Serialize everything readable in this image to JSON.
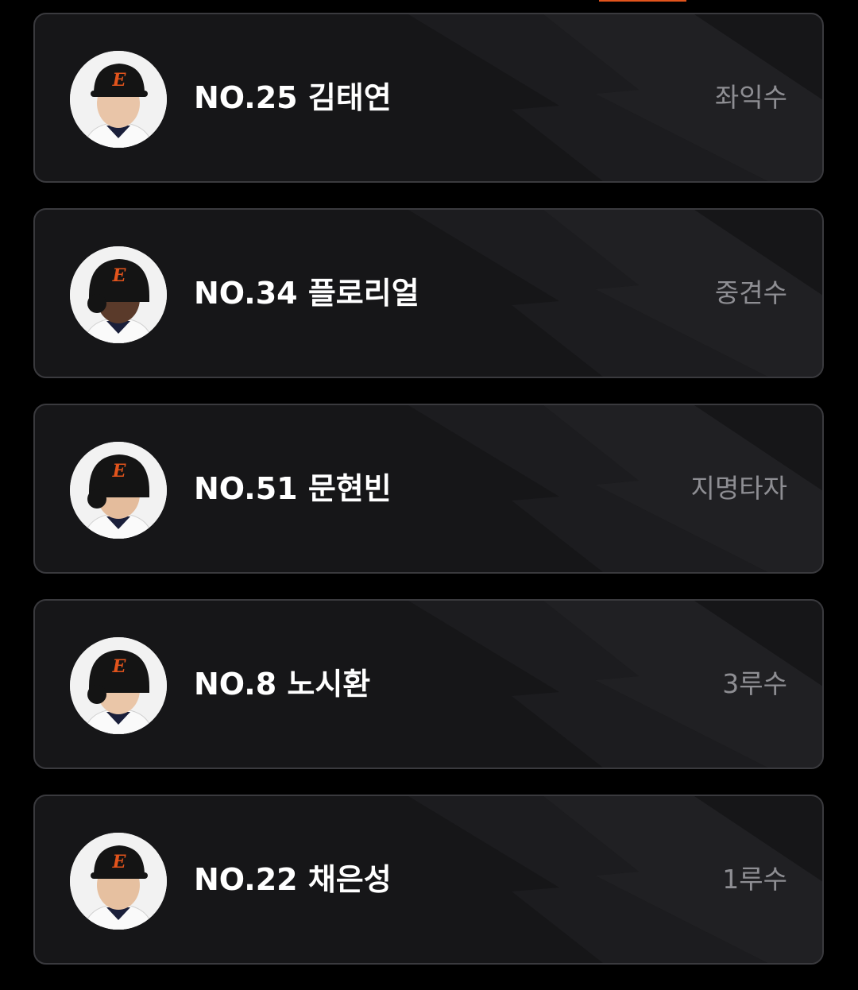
{
  "colors": {
    "background": "#000000",
    "card_background": "#161618",
    "card_border": "#3a3a3e",
    "accent": "#e2541c",
    "name_text": "#ffffff",
    "position_text": "#8e8e93"
  },
  "players": [
    {
      "name": "NO.25 김태연",
      "position": "좌익수",
      "avatar_icon": "player-photo-icon",
      "headwear": "cap",
      "skin": "#e9c5a8"
    },
    {
      "name": "NO.34 플로리얼",
      "position": "중견수",
      "avatar_icon": "player-photo-icon",
      "headwear": "helmet",
      "skin": "#5a3a2a"
    },
    {
      "name": "NO.51 문현빈",
      "position": "지명타자",
      "avatar_icon": "player-photo-icon",
      "headwear": "helmet",
      "skin": "#e4bc9c"
    },
    {
      "name": "NO.8 노시환",
      "position": "3루수",
      "avatar_icon": "player-photo-icon",
      "headwear": "helmet",
      "skin": "#eac6a8"
    },
    {
      "name": "NO.22 채은성",
      "position": "1루수",
      "avatar_icon": "player-photo-icon",
      "headwear": "cap",
      "skin": "#e6c0a0"
    }
  ]
}
